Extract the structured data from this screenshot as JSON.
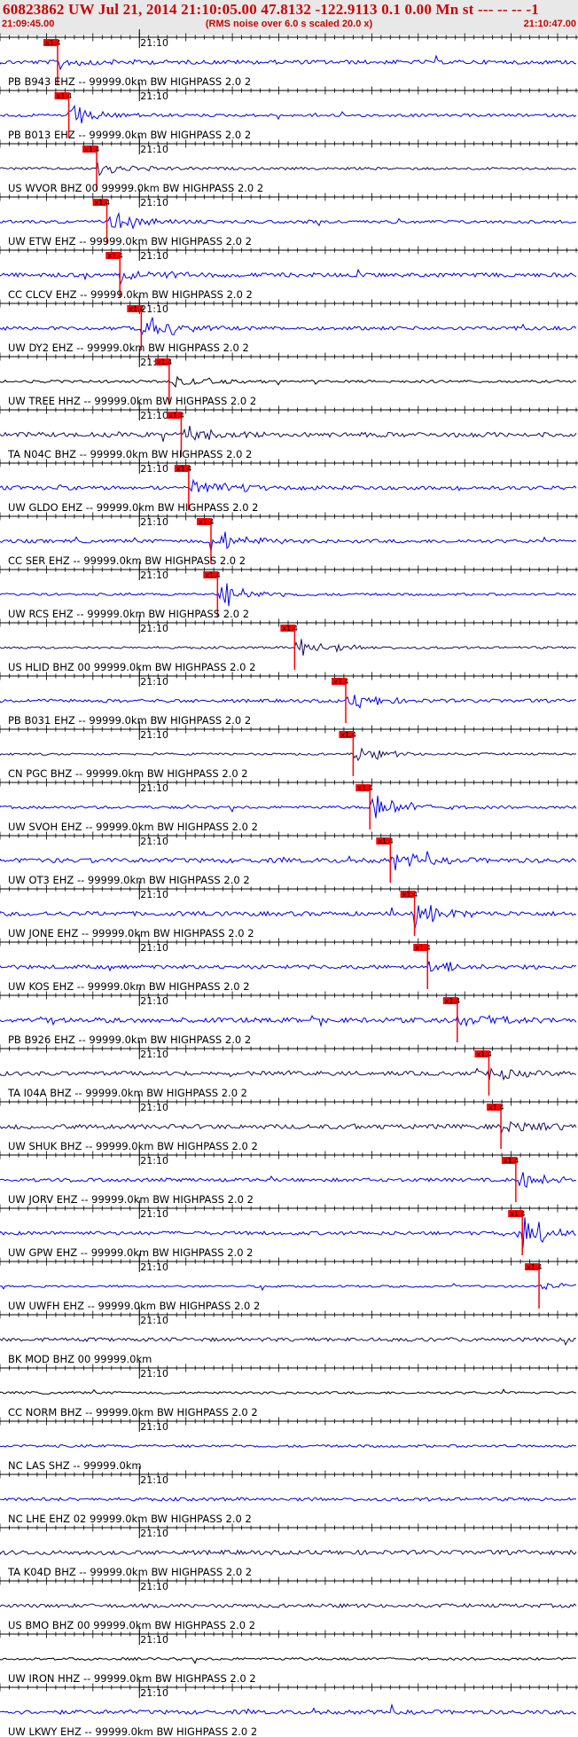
{
  "header": {
    "title": "60823862 UW Jul 21, 2014 21:10:05.00   47.8132 -122.9113  0.1 0.00 Mn st --- -- --  -1",
    "note": "(RMS noise over 6.0 s scaled 20.0 x)",
    "start_time": "21:09:45.00",
    "end_time": "21:10:47.00"
  },
  "colors": {
    "header_text": "#cc0000",
    "header_bg": "#e8e8e8",
    "blue": "#0000ee",
    "navy": "#1a0a5e",
    "black": "#000000",
    "pick": "#ff0000"
  },
  "chart_data": {
    "type": "line",
    "title": "60823862 UW Jul 21, 2014 21:10:05.00   47.8132 -122.9113  0.1 0.00 Mn st --- -- --  -1",
    "x_range": [
      "21:09:45.00",
      "21:10:47.00"
    ],
    "tick_label": "21:10",
    "pick_label": "x1.4",
    "series": [
      {
        "label": "PB B943 EHZ -- 99999.0km BW  HIGHPASS  2.0  2",
        "color": "blue",
        "pick_s": 6.2
      },
      {
        "label": "PB B013 EHZ -- 99999.0km BW  HIGHPASS  2.0  2",
        "color": "blue",
        "pick_s": 7.4
      },
      {
        "label": "US WVOR BHZ 00 99999.0km BW  HIGHPASS  2.0  2",
        "color": "navy",
        "pick_s": 10.4
      },
      {
        "label": "UW ETW EHZ -- 99999.0km BW  HIGHPASS  2.0  2",
        "color": "blue",
        "pick_s": 11.5
      },
      {
        "label": "CC CLCV EHZ -- 99999.0km BW  HIGHPASS  2.0  2",
        "color": "blue",
        "pick_s": 12.9
      },
      {
        "label": "UW DY2 EHZ -- 99999.0km BW  HIGHPASS  2.0  2",
        "color": "blue",
        "pick_s": 15.2
      },
      {
        "label": "UW TREE HHZ -- 99999.0km BW  HIGHPASS  2.0  2",
        "color": "black",
        "pick_s": 18.2
      },
      {
        "label": "TA N04C BHZ -- 99999.0km BW  HIGHPASS  2.0  2",
        "color": "navy",
        "pick_s": 19.5
      },
      {
        "label": "UW GLDO EHZ -- 99999.0km BW  HIGHPASS  2.0  2",
        "color": "blue",
        "pick_s": 20.3
      },
      {
        "label": "CC SER EHZ -- 99999.0km BW  HIGHPASS  2.0  2",
        "color": "blue",
        "pick_s": 22.7
      },
      {
        "label": "UW RCS EHZ -- 99999.0km BW  HIGHPASS  2.0  2",
        "color": "blue",
        "pick_s": 23.4
      },
      {
        "label": "US HLID BHZ 00 99999.0km BW  HIGHPASS  2.0  2",
        "color": "navy",
        "pick_s": 31.7
      },
      {
        "label": "PB B031 EHZ -- 99999.0km BW  HIGHPASS  2.0  2",
        "color": "blue",
        "pick_s": 37.2
      },
      {
        "label": "CN PGC BHZ -- 99999.0km BW  HIGHPASS  2.0  2",
        "color": "navy",
        "pick_s": 38.0
      },
      {
        "label": "UW SVOH EHZ -- 99999.0km BW  HIGHPASS  2.0  2",
        "color": "blue",
        "pick_s": 39.8
      },
      {
        "label": "UW OT3 EHZ -- 99999.0km BW  HIGHPASS  2.0  2",
        "color": "blue",
        "pick_s": 42.0
      },
      {
        "label": "UW JONE EHZ -- 99999.0km BW  HIGHPASS  2.0  2",
        "color": "blue",
        "pick_s": 44.6
      },
      {
        "label": "UW KOS EHZ -- 99999.0km BW  HIGHPASS  2.0  2",
        "color": "blue",
        "pick_s": 46.0
      },
      {
        "label": "PB B926 EHZ -- 99999.0km BW  HIGHPASS  2.0  2",
        "color": "blue",
        "pick_s": 49.2
      },
      {
        "label": "TA I04A BHZ -- 99999.0km BW  HIGHPASS  2.0  2",
        "color": "navy",
        "pick_s": 52.6
      },
      {
        "label": "UW SHUK BHZ -- 99999.0km BW  HIGHPASS  2.0  2",
        "color": "navy",
        "pick_s": 53.9
      },
      {
        "label": "UW JORV EHZ -- 99999.0km BW  HIGHPASS  2.0  2",
        "color": "blue",
        "pick_s": 55.5
      },
      {
        "label": "UW GPW EHZ -- 99999.0km BW  HIGHPASS  2.0  2",
        "color": "blue",
        "pick_s": 56.2
      },
      {
        "label": "UW UWFH EHZ -- 99999.0km BW  HIGHPASS  2.0  2",
        "color": "blue",
        "pick_s": 58.0
      },
      {
        "label": "BK MOD BHZ 00 99999.0km",
        "color": "navy"
      },
      {
        "label": "CC NORM BHZ -- 99999.0km BW  HIGHPASS  2.0  2",
        "color": "black"
      },
      {
        "label": "NC LAS SHZ -- 99999.0km",
        "color": "blue"
      },
      {
        "label": "NC LHE EHZ 02 99999.0km BW  HIGHPASS  2.0  2",
        "color": "blue"
      },
      {
        "label": "TA K04D BHZ -- 99999.0km BW  HIGHPASS  2.0  2",
        "color": "navy"
      },
      {
        "label": "US BMO BHZ 00 99999.0km BW  HIGHPASS  2.0  2",
        "color": "navy"
      },
      {
        "label": "UW IRON HHZ -- 99999.0km BW  HIGHPASS  2.0  2",
        "color": "black"
      },
      {
        "label": "UW LKWY EHZ -- 99999.0km BW  HIGHPASS  2.0  2",
        "color": "blue"
      }
    ]
  }
}
